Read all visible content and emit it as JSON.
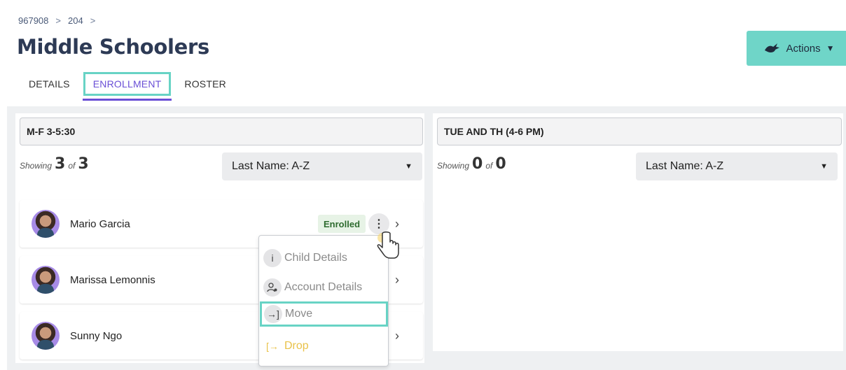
{
  "breadcrumb": {
    "items": [
      "967908",
      "204"
    ],
    "separator": ">"
  },
  "page": {
    "title": "Middle Schoolers"
  },
  "actions": {
    "label": "Actions",
    "icon": "bunny-icon",
    "accent": "#6fd5c8"
  },
  "tabs": [
    {
      "label": "DETAILS",
      "active": false
    },
    {
      "label": "ENROLLMENT",
      "active": true
    },
    {
      "label": "ROSTER",
      "active": false
    }
  ],
  "columns": [
    {
      "title": "M-F 3-5:30",
      "showing_word": "Showing",
      "of_word": "of",
      "shown": "3",
      "total": "3",
      "sort": "Last Name: A-Z",
      "students": [
        {
          "name": "Mario Garcia",
          "status": "Enrolled"
        },
        {
          "name": "Marissa Lemonnis"
        },
        {
          "name": "Sunny Ngo"
        }
      ]
    },
    {
      "title": "TUE AND TH (4-6 PM)",
      "showing_word": "Showing",
      "of_word": "of",
      "shown": "0",
      "total": "0",
      "sort": "Last Name: A-Z",
      "students": []
    }
  ],
  "context_menu": {
    "items": [
      {
        "label": "Child Details",
        "icon": "info-icon"
      },
      {
        "label": "Account Details",
        "icon": "user-gear-icon"
      },
      {
        "label": "Move",
        "icon": "move-icon"
      },
      {
        "label": "Drop",
        "icon": "drop-icon",
        "color": "#e9c24a"
      }
    ]
  },
  "colors": {
    "active_tab": "#6a4fd6",
    "highlight": "#68d3c5",
    "enrolled_bg": "#e7f3e6",
    "enrolled_text": "#2e6b2f"
  }
}
